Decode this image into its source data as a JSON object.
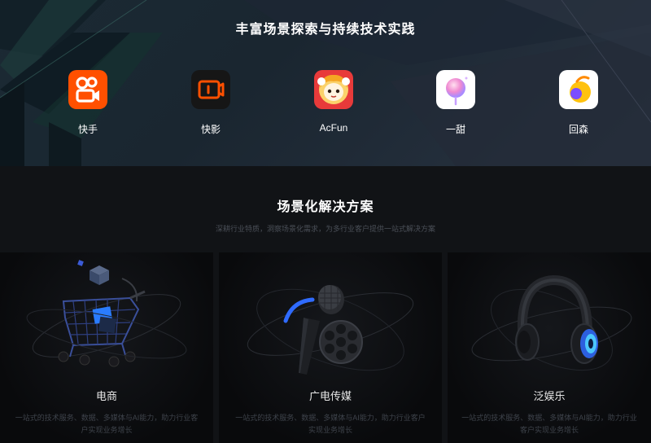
{
  "top": {
    "title": "丰富场景探索与持续技术实践",
    "apps": [
      {
        "name": "快手",
        "icon": "kuaishou-icon"
      },
      {
        "name": "快影",
        "icon": "kuaiying-icon"
      },
      {
        "name": "AcFun",
        "icon": "acfun-icon"
      },
      {
        "name": "一甜",
        "icon": "yitian-icon"
      },
      {
        "name": "回森",
        "icon": "huisen-icon"
      }
    ]
  },
  "solutions": {
    "title": "场景化解决方案",
    "subtitle": "深耕行业特质，洞察场景化需求，为多行业客户提供一站式解决方案",
    "cards": [
      {
        "title": "电商",
        "desc": "一站式的技术服务、数据、多媒体与AI能力，助力行业客户实现业务增长",
        "icon": "shopping-cart-icon"
      },
      {
        "title": "广电传媒",
        "desc": "一站式的技术服务、数据、多媒体与AI能力，助力行业客户实现业务增长",
        "icon": "microphone-film-icon"
      },
      {
        "title": "泛娱乐",
        "desc": "一站式的技术服务、数据、多媒体与AI能力，助力行业客户实现业务增长",
        "icon": "headphones-icon"
      }
    ]
  },
  "colors": {
    "kuaishou": "#ff5000",
    "kuaiying": "#1a1a1a",
    "acfun": "#e83a3a",
    "accent_blue": "#2f6bff"
  }
}
